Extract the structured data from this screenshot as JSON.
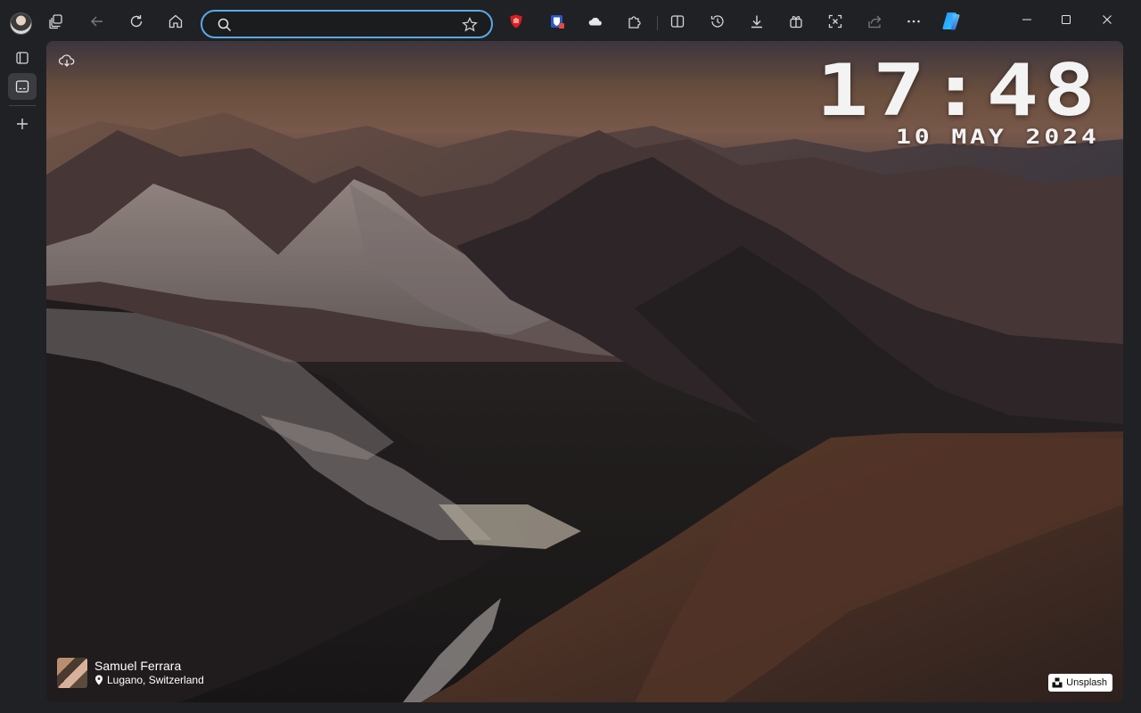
{
  "address_bar": {
    "value": "",
    "placeholder": ""
  },
  "clock": {
    "time": "17:48",
    "date": "10 MAY 2024"
  },
  "photo_credit": {
    "author": "Samuel Ferrara",
    "location": "Lugano, Switzerland"
  },
  "badge": {
    "label": "Unsplash"
  },
  "colors": {
    "address_focus": "#5aa9e6",
    "chrome_bg": "#202124",
    "ublock_red": "#d8201f",
    "bitwarden_blue": "#2a59c9"
  },
  "icons": {
    "toolbar": [
      "profile-avatar",
      "workspaces-icon",
      "back-icon",
      "refresh-icon",
      "home-icon",
      "search-icon",
      "favorite-star-icon",
      "ublock-icon",
      "bitwarden-icon",
      "cloud-extension-icon",
      "extensions-icon",
      "split-screen-icon",
      "history-icon",
      "downloads-icon",
      "collections-icon",
      "screenshot-icon",
      "share-icon",
      "more-icon",
      "copilot-icon"
    ],
    "window": [
      "minimize-icon",
      "maximize-icon",
      "close-icon"
    ],
    "sidebar": [
      "tab-actions-icon",
      "vertical-tabs-icon",
      "new-tab-icon"
    ]
  }
}
